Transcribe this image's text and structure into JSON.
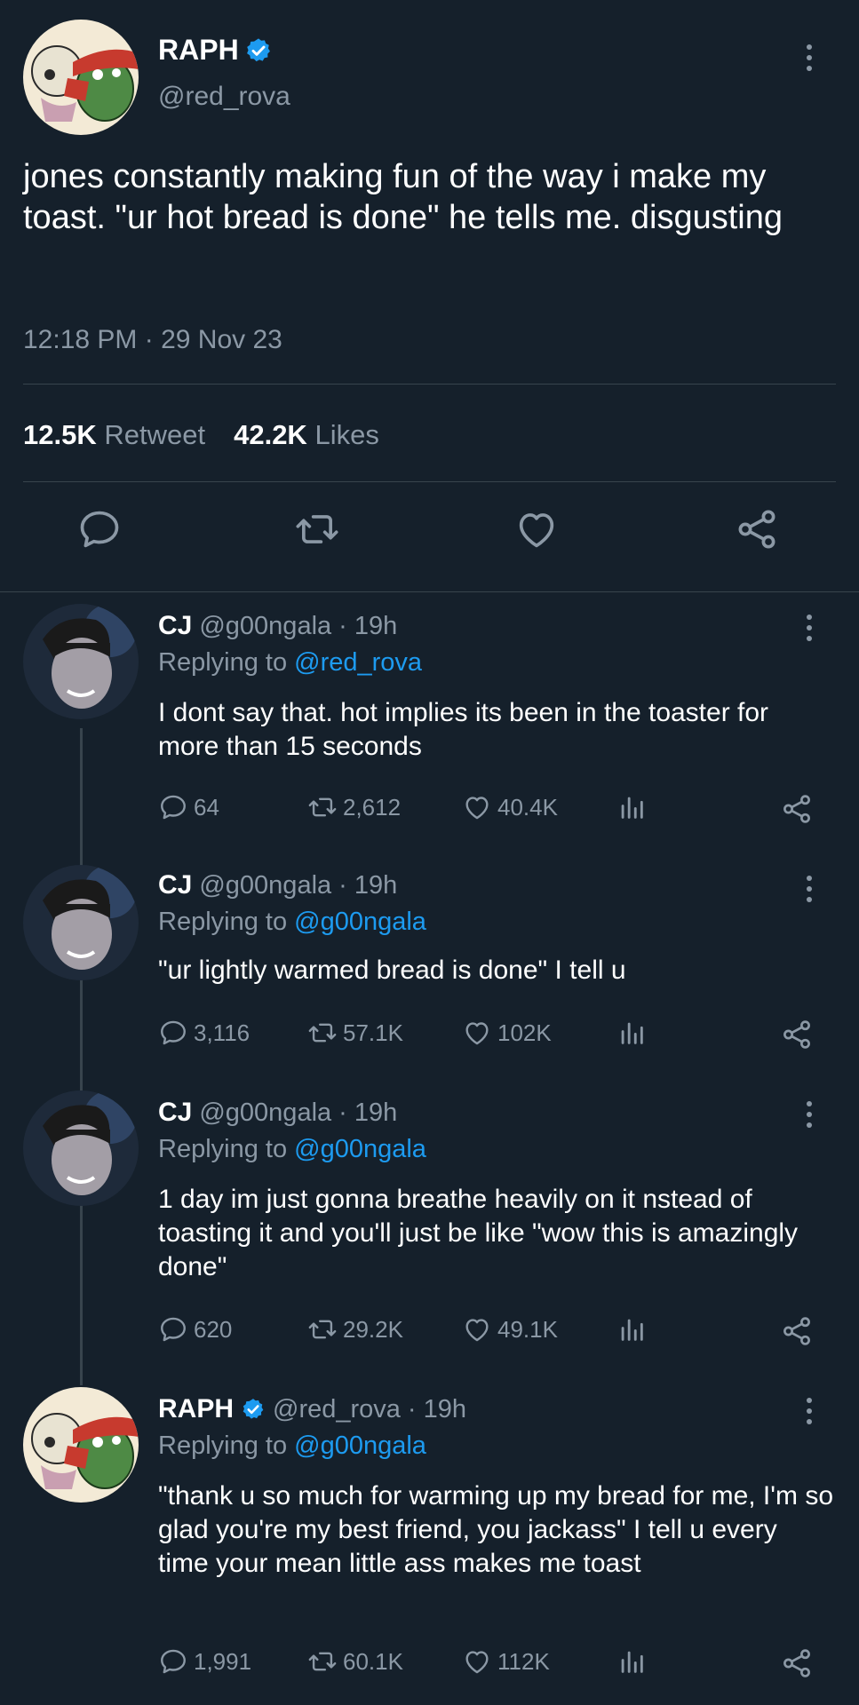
{
  "main_tweet": {
    "display_name": "RAPH",
    "handle": "@red_rova",
    "text": "jones constantly making fun of the way i make my toast. \"ur hot bread is done\" he tells me. disgusting",
    "timestamp": "12:18 PM · 29 Nov 23",
    "retweet_count": "12.5K",
    "retweet_label": "Retweet",
    "like_count": "42.2K",
    "like_label": "Likes"
  },
  "replies": [
    {
      "display_name": "CJ",
      "handle": "@g00ngala",
      "time": "19h",
      "replying_to_label": "Replying to",
      "replying_to": "@red_rova",
      "text": "I dont say that. hot implies its been in the toaster for more than 15 seconds",
      "replies": "64",
      "retweets": "2,612",
      "likes": "40.4K"
    },
    {
      "display_name": "CJ",
      "handle": "@g00ngala",
      "time": "19h",
      "replying_to_label": "Replying to",
      "replying_to": "@g00ngala",
      "text": "\"ur lightly warmed bread is done\" I tell u",
      "replies": "3,116",
      "retweets": "57.1K",
      "likes": "102K"
    },
    {
      "display_name": "CJ",
      "handle": "@g00ngala",
      "time": "19h",
      "replying_to_label": "Replying to",
      "replying_to": "@g00ngala",
      "text": "1 day im just gonna breathe heavily on it nstead of toasting it and you'll just be like \"wow this is amazingly done\"",
      "replies": "620",
      "retweets": "29.2K",
      "likes": "49.1K"
    },
    {
      "display_name": "RAPH",
      "handle": "@red_rova",
      "time": "19h",
      "replying_to_label": "Replying to",
      "replying_to": "@g00ngala",
      "text": "\"thank u so much for warming up my bread for me, I'm so glad you're my best friend, you jackass\" I tell u every time your mean little ass makes me toast",
      "replies": "1,991",
      "retweets": "60.1K",
      "likes": "112K"
    }
  ],
  "colors": {
    "background": "#15202b",
    "muted_text": "#8b98a5",
    "link": "#1d9bf0",
    "divider": "#38444d",
    "verified": "#1d9bf0"
  },
  "icons": [
    "reply-icon",
    "retweet-icon",
    "like-icon",
    "share-icon",
    "analytics-icon",
    "more-icon",
    "verified-badge-icon"
  ]
}
